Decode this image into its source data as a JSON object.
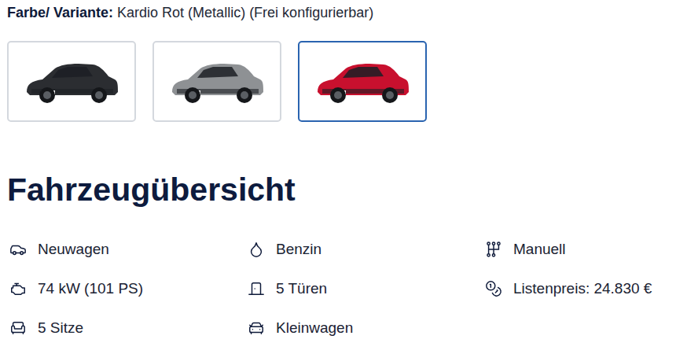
{
  "variant": {
    "label": "Farbe/ Variante:",
    "value": "Kardio Rot (Metallic) (Frei konfigurierbar)"
  },
  "variants": [
    {
      "selected": false,
      "color": "#2b2d31"
    },
    {
      "selected": false,
      "color": "#8e9194"
    },
    {
      "selected": true,
      "color": "#c8102e"
    }
  ],
  "overview": {
    "title": "Fahrzeugübersicht",
    "specs": [
      {
        "text": "Neuwagen"
      },
      {
        "text": "Benzin"
      },
      {
        "text": "Manuell"
      },
      {
        "text": "74 kW (101 PS)"
      },
      {
        "text": "5 Türen"
      },
      {
        "text": "Listenpreis: 24.830 €"
      },
      {
        "text": "5 Sitze"
      },
      {
        "text": "Kleinwagen"
      }
    ]
  }
}
